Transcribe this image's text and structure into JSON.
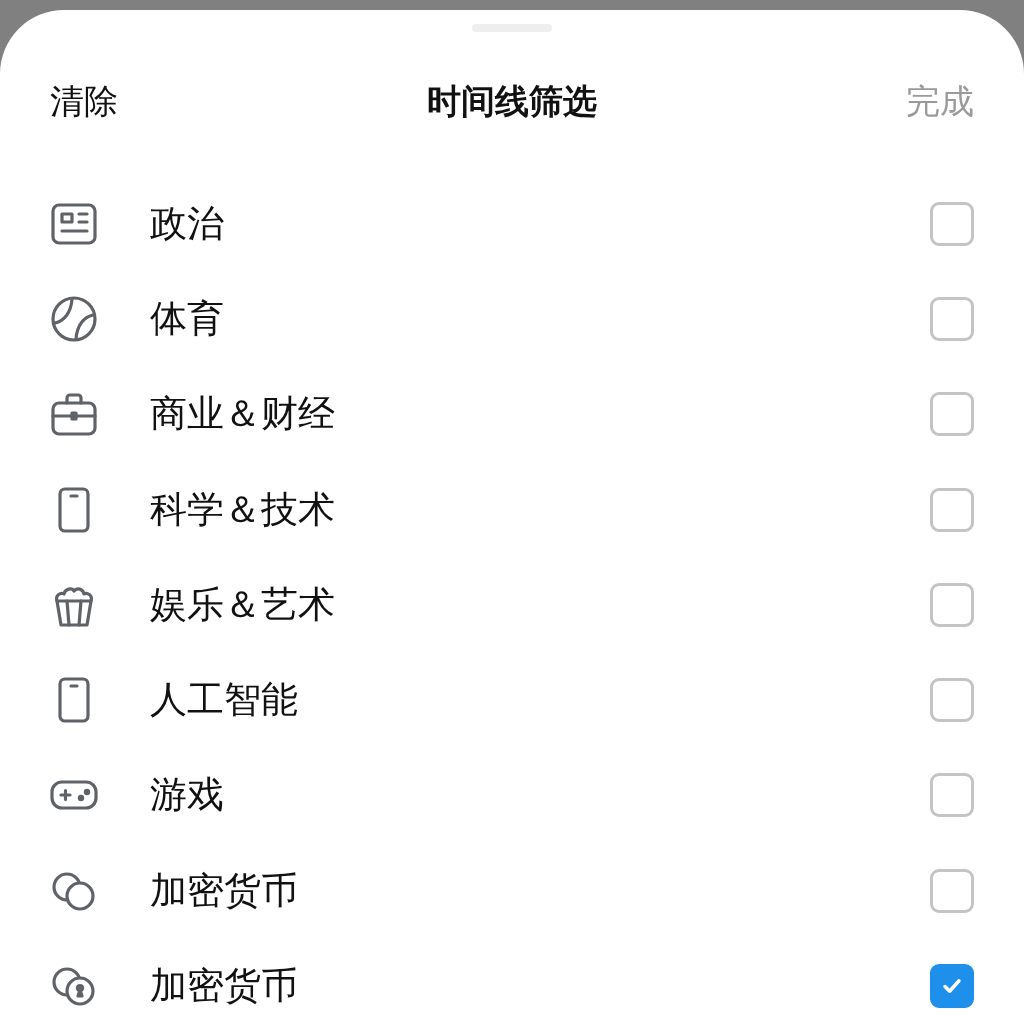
{
  "header": {
    "clear": "清除",
    "title": "时间线筛选",
    "done": "完成",
    "done_disabled": true
  },
  "items": [
    {
      "label": "政治",
      "checked": false
    },
    {
      "label": "体育",
      "checked": false
    },
    {
      "label": "商业＆财经",
      "checked": false
    },
    {
      "label": "科学＆技术",
      "checked": false
    },
    {
      "label": "娱乐＆艺术",
      "checked": false
    },
    {
      "label": "人工智能",
      "checked": false
    },
    {
      "label": "游戏",
      "checked": false
    },
    {
      "label": "加密货币",
      "checked": false
    },
    {
      "label": "加密货币",
      "checked": true
    }
  ]
}
